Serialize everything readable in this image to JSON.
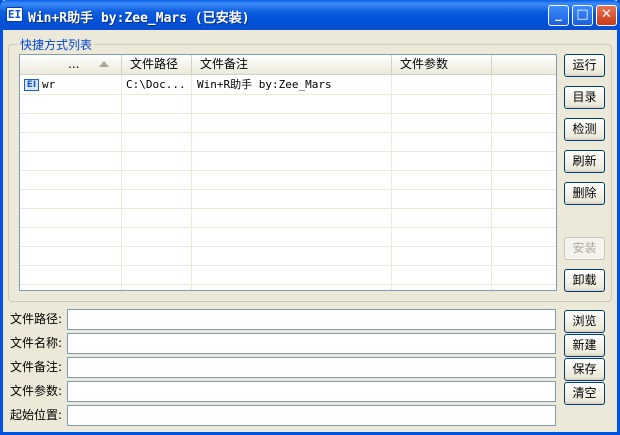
{
  "window": {
    "title": "Win+R助手 by:Zee_Mars (已安装)",
    "icon_glyph": "EI",
    "min_glyph": "_",
    "max_glyph": "□",
    "close_glyph": "✕"
  },
  "shortcut_list": {
    "group_label": "快捷方式列表",
    "columns": [
      "...",
      "文件路径",
      "文件备注",
      "文件参数"
    ],
    "rows": [
      {
        "icon_glyph": "EI",
        "name": "wr",
        "path": "C:\\Doc...",
        "note": "Win+R助手 by:Zee_Mars",
        "params": ""
      }
    ]
  },
  "side_buttons": {
    "run": "运行",
    "catalog": "目录",
    "check": "检测",
    "refresh": "刷新",
    "delete": "删除",
    "install": "安装",
    "uninstall": "卸载"
  },
  "form": {
    "path_label": "文件路径:",
    "path_value": "",
    "name_label": "文件名称:",
    "name_value": "",
    "note_label": "文件备注:",
    "note_value": "",
    "params_label": "文件参数:",
    "params_value": "",
    "start_label": "起始位置:",
    "start_value": ""
  },
  "form_buttons": {
    "browse": "浏览",
    "new": "新建",
    "save": "保存",
    "clear": "清空"
  },
  "icons": [
    "app-icon",
    "minimize-icon",
    "maximize-icon",
    "close-icon",
    "sort-ascending-icon",
    "shortcut-file-icon"
  ]
}
